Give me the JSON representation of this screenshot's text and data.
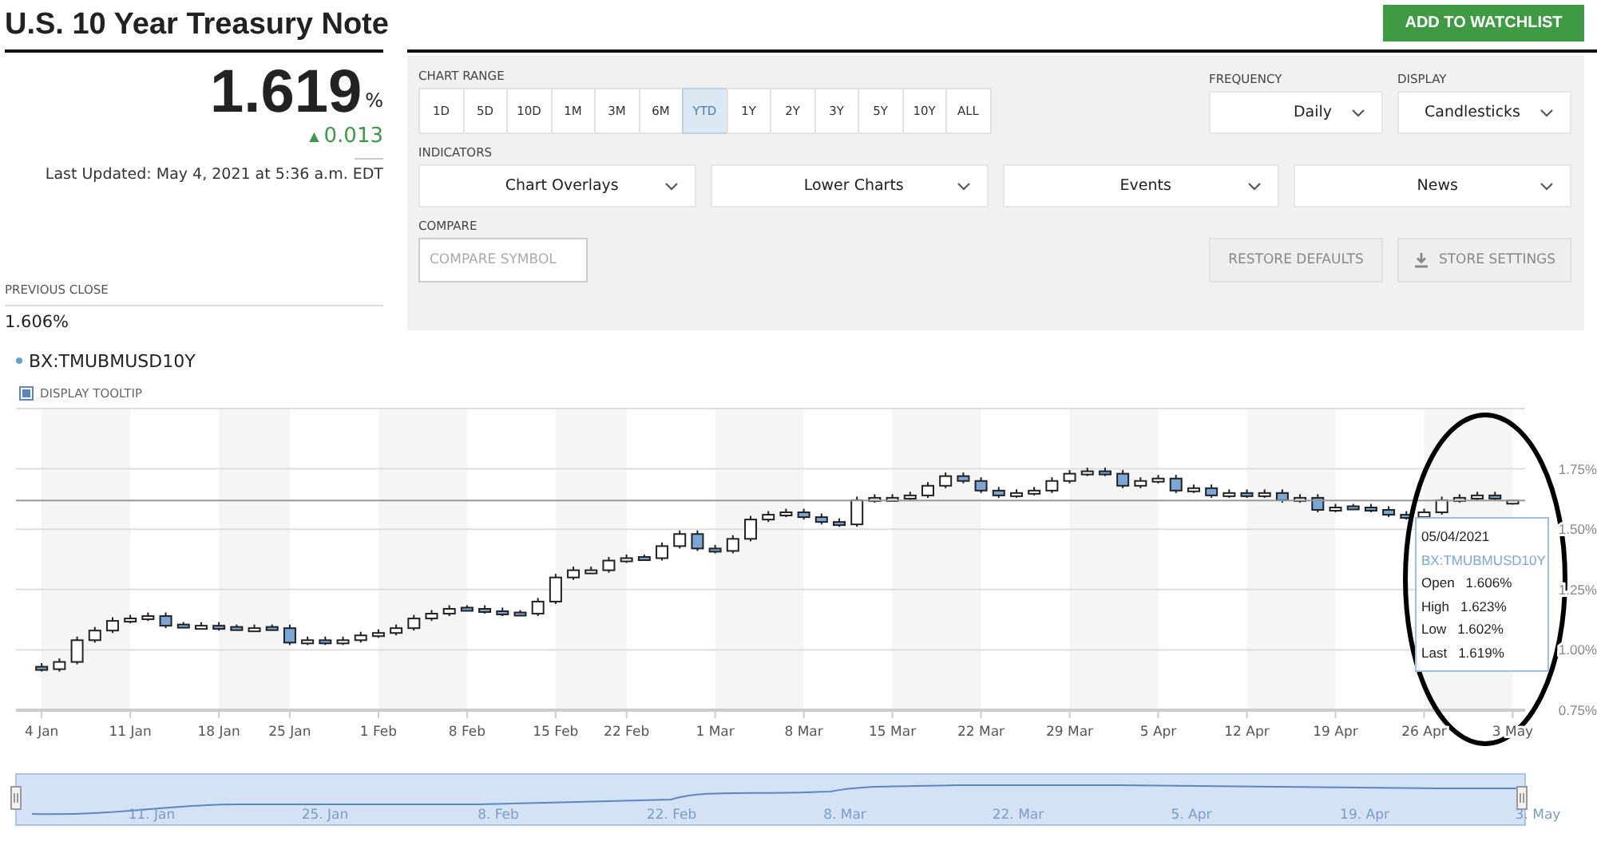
{
  "header": {
    "title": "U.S. 10 Year Treasury Note",
    "watchlist_button": "ADD TO WATCHLIST"
  },
  "quote": {
    "price": "1.619",
    "unit": "%",
    "change_icon": "▲",
    "change": "0.013",
    "last_updated": "Last Updated: May 4, 2021 at 5:36 a.m. EDT",
    "previous_close_label": "PREVIOUS CLOSE",
    "previous_close": "1.606%"
  },
  "controls": {
    "chart_range": {
      "label": "CHART RANGE",
      "options": [
        {
          "label": "1D",
          "selected": false
        },
        {
          "label": "5D",
          "selected": false
        },
        {
          "label": "10D",
          "selected": false
        },
        {
          "label": "1M",
          "selected": false
        },
        {
          "label": "3M",
          "selected": false
        },
        {
          "label": "6M",
          "selected": false
        },
        {
          "label": "YTD",
          "selected": true
        },
        {
          "label": "1Y",
          "selected": false
        },
        {
          "label": "2Y",
          "selected": false
        },
        {
          "label": "3Y",
          "selected": false
        },
        {
          "label": "5Y",
          "selected": false
        },
        {
          "label": "10Y",
          "selected": false
        },
        {
          "label": "ALL",
          "selected": false
        }
      ]
    },
    "frequency": {
      "label": "FREQUENCY",
      "value": "Daily"
    },
    "display": {
      "label": "DISPLAY",
      "value": "Candlesticks"
    },
    "indicators": {
      "label": "INDICATORS",
      "menus": [
        "Chart Overlays",
        "Lower Charts",
        "Events",
        "News"
      ]
    },
    "compare": {
      "label": "COMPARE",
      "placeholder": "COMPARE SYMBOL"
    },
    "buttons": [
      {
        "label": "RESTORE DEFAULTS",
        "kind": "plain"
      },
      {
        "label": "STORE SETTINGS",
        "kind": "download"
      }
    ]
  },
  "chart": {
    "symbol": "BX:TMUBMUSD10Y",
    "tooltip_toggle": {
      "label": "DISPLAY TOOLTIP",
      "checked": true
    },
    "chart_data": {
      "type": "candlestick",
      "grid": true,
      "ylim": [
        0.75,
        2.0
      ],
      "categories": [
        "4 Jan",
        null,
        null,
        null,
        null,
        "11 Jan",
        null,
        null,
        null,
        null,
        "18 Jan",
        null,
        null,
        null,
        "25 Jan",
        null,
        null,
        null,
        null,
        "1 Feb",
        null,
        null,
        null,
        null,
        "8 Feb",
        null,
        null,
        null,
        null,
        "15 Feb",
        null,
        null,
        null,
        "22 Feb",
        null,
        null,
        null,
        null,
        "1 Mar",
        null,
        null,
        null,
        null,
        "8 Mar",
        null,
        null,
        null,
        null,
        "15 Mar",
        null,
        null,
        null,
        null,
        "22 Mar",
        null,
        null,
        null,
        null,
        "29 Mar",
        null,
        null,
        null,
        null,
        "5 Apr",
        null,
        null,
        null,
        null,
        "12 Apr",
        null,
        null,
        null,
        null,
        "19 Apr",
        null,
        null,
        null,
        null,
        "26 Apr",
        null,
        null,
        null,
        null,
        "3 May"
      ],
      "ref_lines": [
        {
          "axis": "y",
          "value": 1.619
        }
      ],
      "ohlc": [
        [
          0.93,
          0.945,
          0.91,
          0.92
        ],
        [
          0.92,
          0.965,
          0.91,
          0.95
        ],
        [
          0.95,
          1.055,
          0.94,
          1.04
        ],
        [
          1.04,
          1.095,
          1.03,
          1.08
        ],
        [
          1.08,
          1.135,
          1.07,
          1.12
        ],
        [
          1.12,
          1.145,
          1.11,
          1.13
        ],
        [
          1.13,
          1.155,
          1.12,
          1.14
        ],
        [
          1.14,
          1.155,
          1.09,
          1.1
        ],
        [
          1.105,
          1.115,
          1.09,
          1.1
        ],
        [
          1.095,
          1.115,
          1.09,
          1.1
        ],
        [
          1.1,
          1.115,
          1.08,
          1.09
        ],
        [
          1.095,
          1.105,
          1.08,
          1.09
        ],
        [
          1.085,
          1.105,
          1.08,
          1.09
        ],
        [
          1.095,
          1.105,
          1.08,
          1.09
        ],
        [
          1.09,
          1.105,
          1.02,
          1.03
        ],
        [
          1.03,
          1.055,
          1.02,
          1.04
        ],
        [
          1.04,
          1.055,
          1.02,
          1.03
        ],
        [
          1.03,
          1.055,
          1.02,
          1.04
        ],
        [
          1.04,
          1.075,
          1.03,
          1.06
        ],
        [
          1.06,
          1.085,
          1.05,
          1.07
        ],
        [
          1.07,
          1.105,
          1.06,
          1.09
        ],
        [
          1.09,
          1.145,
          1.08,
          1.13
        ],
        [
          1.13,
          1.165,
          1.12,
          1.15
        ],
        [
          1.15,
          1.185,
          1.14,
          1.17
        ],
        [
          1.175,
          1.185,
          1.16,
          1.17
        ],
        [
          1.17,
          1.185,
          1.15,
          1.16
        ],
        [
          1.16,
          1.175,
          1.14,
          1.15
        ],
        [
          1.155,
          1.165,
          1.14,
          1.15
        ],
        [
          1.15,
          1.215,
          1.14,
          1.2
        ],
        [
          1.2,
          1.315,
          1.19,
          1.3
        ],
        [
          1.3,
          1.345,
          1.29,
          1.33
        ],
        [
          1.325,
          1.345,
          1.32,
          1.33
        ],
        [
          1.33,
          1.385,
          1.32,
          1.37
        ],
        [
          1.37,
          1.395,
          1.36,
          1.38
        ],
        [
          1.385,
          1.395,
          1.37,
          1.38
        ],
        [
          1.38,
          1.445,
          1.37,
          1.43
        ],
        [
          1.43,
          1.495,
          1.42,
          1.48
        ],
        [
          1.48,
          1.495,
          1.41,
          1.42
        ],
        [
          1.42,
          1.435,
          1.4,
          1.41
        ],
        [
          1.41,
          1.475,
          1.4,
          1.46
        ],
        [
          1.46,
          1.555,
          1.45,
          1.54
        ],
        [
          1.54,
          1.575,
          1.53,
          1.56
        ],
        [
          1.56,
          1.585,
          1.55,
          1.57
        ],
        [
          1.57,
          1.585,
          1.54,
          1.55
        ],
        [
          1.55,
          1.565,
          1.52,
          1.53
        ],
        [
          1.53,
          1.545,
          1.51,
          1.52
        ],
        [
          1.52,
          1.635,
          1.51,
          1.62
        ],
        [
          1.62,
          1.645,
          1.61,
          1.63
        ],
        [
          1.625,
          1.645,
          1.62,
          1.63
        ],
        [
          1.63,
          1.655,
          1.62,
          1.64
        ],
        [
          1.64,
          1.695,
          1.63,
          1.68
        ],
        [
          1.68,
          1.735,
          1.67,
          1.72
        ],
        [
          1.72,
          1.735,
          1.69,
          1.7
        ],
        [
          1.7,
          1.715,
          1.65,
          1.66
        ],
        [
          1.66,
          1.675,
          1.63,
          1.64
        ],
        [
          1.64,
          1.665,
          1.63,
          1.65
        ],
        [
          1.65,
          1.675,
          1.64,
          1.66
        ],
        [
          1.66,
          1.715,
          1.65,
          1.7
        ],
        [
          1.7,
          1.745,
          1.69,
          1.73
        ],
        [
          1.73,
          1.755,
          1.72,
          1.74
        ],
        [
          1.74,
          1.755,
          1.72,
          1.73
        ],
        [
          1.73,
          1.745,
          1.67,
          1.68
        ],
        [
          1.68,
          1.715,
          1.67,
          1.7
        ],
        [
          1.7,
          1.725,
          1.69,
          1.71
        ],
        [
          1.71,
          1.725,
          1.65,
          1.66
        ],
        [
          1.66,
          1.685,
          1.65,
          1.67
        ],
        [
          1.67,
          1.685,
          1.63,
          1.64
        ],
        [
          1.64,
          1.665,
          1.63,
          1.65
        ],
        [
          1.65,
          1.665,
          1.63,
          1.64
        ],
        [
          1.64,
          1.665,
          1.63,
          1.65
        ],
        [
          1.65,
          1.665,
          1.61,
          1.62
        ],
        [
          1.62,
          1.645,
          1.61,
          1.63
        ],
        [
          1.63,
          1.645,
          1.57,
          1.58
        ],
        [
          1.58,
          1.605,
          1.57,
          1.59
        ],
        [
          1.595,
          1.605,
          1.58,
          1.59
        ],
        [
          1.59,
          1.605,
          1.57,
          1.58
        ],
        [
          1.58,
          1.595,
          1.55,
          1.56
        ],
        [
          1.56,
          1.575,
          1.54,
          1.55
        ],
        [
          1.55,
          1.585,
          1.54,
          1.57
        ],
        [
          1.57,
          1.635,
          1.56,
          1.62
        ],
        [
          1.62,
          1.645,
          1.61,
          1.63
        ],
        [
          1.63,
          1.655,
          1.62,
          1.64
        ],
        [
          1.64,
          1.655,
          1.62,
          1.63
        ],
        [
          1.606,
          1.623,
          1.602,
          1.619
        ]
      ],
      "yticks": [
        {
          "value": 1.75,
          "label": "1.75%"
        },
        {
          "value": 1.5,
          "label": "1.50%"
        },
        {
          "value": 1.25,
          "label": "1.25%"
        },
        {
          "value": 1.0,
          "label": "1.00%"
        },
        {
          "value": 0.75,
          "label": "0.75%"
        }
      ]
    },
    "tooltip": {
      "date": "05/04/2021",
      "symbol": "BX:TMUBMUSD10Y",
      "rows": [
        {
          "label": "Open",
          "value": "1.606%"
        },
        {
          "label": "High",
          "value": "1.623%"
        },
        {
          "label": "Low",
          "value": "1.602%"
        },
        {
          "label": "Last",
          "value": "1.619%"
        }
      ]
    },
    "navigator_labels": [
      "11. Jan",
      "25. Jan",
      "8. Feb",
      "22. Feb",
      "8. Mar",
      "22. Mar",
      "5. Apr",
      "19. Apr",
      "3. May"
    ]
  }
}
